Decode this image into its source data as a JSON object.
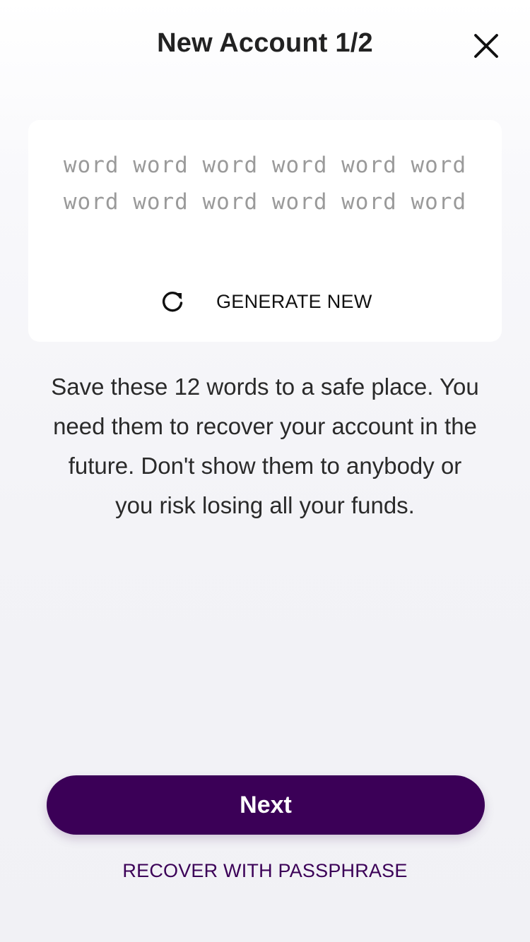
{
  "header": {
    "title": "New Account 1/2",
    "close_icon": "close-icon"
  },
  "mnemonic": {
    "lines": [
      "word word word word word word",
      "word word word word word word"
    ],
    "generate_label": "GENERATE NEW",
    "generate_icon": "refresh-icon"
  },
  "info_text": "Save these 12 words to a safe place. You need them to recover your account in the future. Don't show them to anybody or you risk losing all your funds.",
  "actions": {
    "next_label": "Next",
    "recover_label": "RECOVER WITH PASSPHRASE"
  },
  "colors": {
    "accent": "#3b0057",
    "placeholder_text": "#9a9a9a"
  }
}
